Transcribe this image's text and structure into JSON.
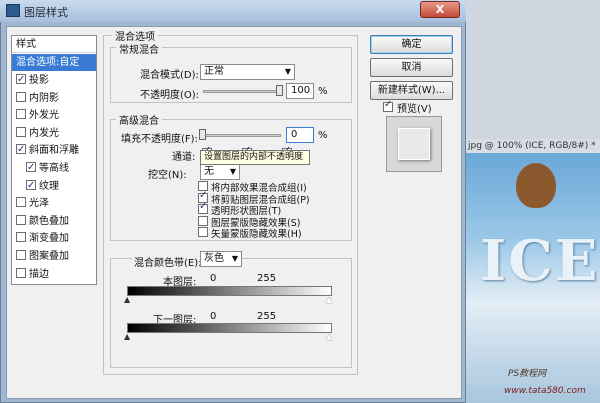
{
  "window": {
    "title": "图层样式",
    "close_label": "X"
  },
  "style_list": {
    "header": "样式",
    "blend_options": "混合选项:自定",
    "items": [
      {
        "label": "投影",
        "checked": true,
        "indent": false
      },
      {
        "label": "内阴影",
        "checked": false,
        "indent": false
      },
      {
        "label": "外发光",
        "checked": false,
        "indent": false
      },
      {
        "label": "内发光",
        "checked": false,
        "indent": false
      },
      {
        "label": "斜面和浮雕",
        "checked": true,
        "indent": false
      },
      {
        "label": "等高线",
        "checked": true,
        "indent": true
      },
      {
        "label": "纹理",
        "checked": true,
        "indent": true
      },
      {
        "label": "光泽",
        "checked": false,
        "indent": false
      },
      {
        "label": "颜色叠加",
        "checked": false,
        "indent": false
      },
      {
        "label": "渐变叠加",
        "checked": false,
        "indent": false
      },
      {
        "label": "图案叠加",
        "checked": false,
        "indent": false
      },
      {
        "label": "描边",
        "checked": false,
        "indent": false
      }
    ]
  },
  "blend_options": {
    "section_title": "混合选项",
    "general": {
      "title": "常规混合",
      "mode_label": "混合模式(D):",
      "mode_value": "正常",
      "opacity_label": "不透明度(O):",
      "opacity_value": "100",
      "opacity_unit": "%"
    },
    "advanced": {
      "title": "高级混合",
      "fill_opacity_label": "填充不透明度(F):",
      "fill_opacity_value": "0",
      "fill_opacity_unit": "%",
      "channels_label": "通道:",
      "knockout_label": "挖空(N):",
      "knockout_value": "无",
      "options": [
        {
          "label": "将内部效果混合成组(I)",
          "checked": false
        },
        {
          "label": "将剪贴图层混合成组(P)",
          "checked": true
        },
        {
          "label": "透明形状图层(T)",
          "checked": true
        },
        {
          "label": "图层蒙版隐藏效果(S)",
          "checked": false
        },
        {
          "label": "矢量蒙版隐藏效果(H)",
          "checked": false
        }
      ]
    },
    "blend_if": {
      "label": "混合颜色带(E):",
      "value": "灰色",
      "this_layer_label": "本图层:",
      "this_layer_min": "0",
      "this_layer_max": "255",
      "underlying_label": "下一图层:",
      "underlying_min": "0",
      "underlying_max": "255"
    }
  },
  "tooltip": "设置图层的内部不透明度",
  "buttons": {
    "ok": "确定",
    "cancel": "取消",
    "new_style": "新建样式(W)...",
    "preview": "预览(V)",
    "preview_checked": true
  },
  "document": {
    "title": "jpg @ 100% (ICE, RGB/8#) *",
    "canvas_text": "ICE",
    "watermark_line1": "PS教程网",
    "watermark_line2": "www.tata580.com"
  },
  "colors": {
    "selection": "#3a7bd5",
    "tooltip_bg": "#ffffe1",
    "close_button": "#c7493a"
  }
}
